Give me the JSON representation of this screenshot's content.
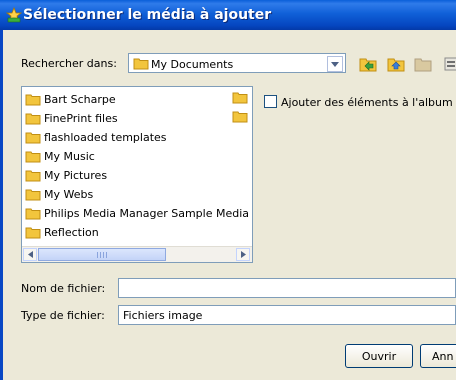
{
  "dialog": {
    "title": "Sélectionner le média à ajouter"
  },
  "lookin": {
    "label": "Rechercher dans:",
    "value": "My Documents"
  },
  "toolbar": {
    "icons": [
      "back-icon",
      "up-folder-icon",
      "new-folder-icon",
      "views-menu-icon"
    ]
  },
  "files": [
    "Bart Scharpe",
    "FinePrint files",
    "flashloaded templates",
    "My Music",
    "My Pictures",
    "My Webs",
    "Philips Media Manager Sample Media",
    "Reflection"
  ],
  "option": {
    "label": "Ajouter des éléments à l'album d'im"
  },
  "filename": {
    "label": "Nom de fichier:",
    "value": ""
  },
  "filetype": {
    "label": "Type de fichier:",
    "value": "Fichiers image"
  },
  "buttons": {
    "open": "Ouvrir",
    "cancel": "Ann"
  },
  "colors": {
    "titlebar": "#0a5fd8",
    "dialog_bg": "#ece9d8",
    "folder": "#f2c53d"
  }
}
